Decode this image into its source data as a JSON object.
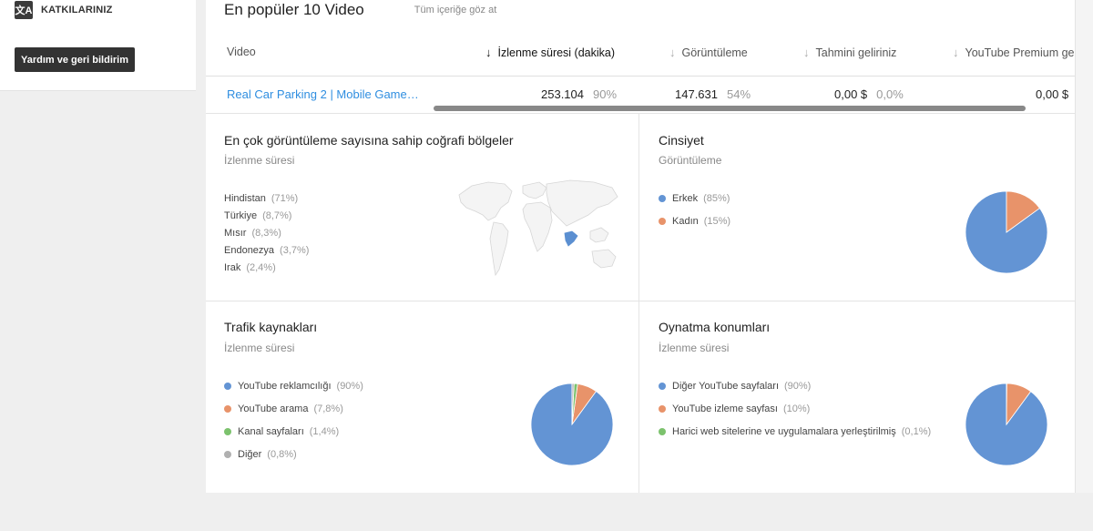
{
  "sidebar": {
    "contributions_label": "KATKILARINIZ",
    "contributions_icon": "translate-icon",
    "help_button": "Yardım ve geri bildirim"
  },
  "top_videos": {
    "title": "En popüler 10 Video",
    "see_all": "Tüm içeriğe göz at",
    "columns": [
      {
        "label": "Video"
      },
      {
        "label": "İzlenme süresi (dakika)"
      },
      {
        "label": "Görüntüleme"
      },
      {
        "label": "Tahmini geliriniz"
      },
      {
        "label": "YouTube Premium ge"
      }
    ],
    "rows": [
      {
        "video": "Real Car Parking 2 | Mobile Game…",
        "watch_time": "253.104",
        "watch_time_pct": "90%",
        "views": "147.631",
        "views_pct": "54%",
        "revenue": "0,00 $",
        "revenue_pct": "0,0%",
        "premium": "0,00 $"
      }
    ],
    "scroll_position": 0.3
  },
  "geo": {
    "title": "En çok görüntüleme sayısına sahip coğrafi bölgeler",
    "subtitle": "İzlenme süresi",
    "items": [
      {
        "label": "Hindistan",
        "pct": "(71%)"
      },
      {
        "label": "Türkiye",
        "pct": "(8,7%)"
      },
      {
        "label": "Mısır",
        "pct": "(8,3%)"
      },
      {
        "label": "Endonezya",
        "pct": "(3,7%)"
      },
      {
        "label": "Irak",
        "pct": "(2,4%)"
      }
    ],
    "highlight_color": "#5b8fd1"
  },
  "gender": {
    "title": "Cinsiyet",
    "subtitle": "Görüntüleme",
    "items": [
      {
        "label": "Erkek",
        "pct": "(85%)",
        "value": 85,
        "color": "#6394d4"
      },
      {
        "label": "Kadın",
        "pct": "(15%)",
        "value": 15,
        "color": "#e8936a"
      }
    ]
  },
  "traffic": {
    "title": "Trafik kaynakları",
    "subtitle": "İzlenme süresi",
    "items": [
      {
        "label": "YouTube reklamcılığı",
        "pct": "(90%)",
        "value": 90,
        "color": "#6394d4"
      },
      {
        "label": "YouTube arama",
        "pct": "(7,8%)",
        "value": 7.8,
        "color": "#e8936a"
      },
      {
        "label": "Kanal sayfaları",
        "pct": "(1,4%)",
        "value": 1.4,
        "color": "#7cc26d"
      },
      {
        "label": "Diğer",
        "pct": "(0,8%)",
        "value": 0.8,
        "color": "#b0b0b0"
      }
    ]
  },
  "playback": {
    "title": "Oynatma konumları",
    "subtitle": "İzlenme süresi",
    "items": [
      {
        "label": "Diğer YouTube sayfaları",
        "pct": "(90%)",
        "value": 90,
        "color": "#6394d4"
      },
      {
        "label": "YouTube izleme sayfası",
        "pct": "(10%)",
        "value": 10,
        "color": "#e8936a"
      },
      {
        "label": "Harici web sitelerine ve uygulamalara yerleştirilmiş",
        "pct": "(0,1%)",
        "value": 0.1,
        "color": "#7cc26d"
      }
    ]
  }
}
